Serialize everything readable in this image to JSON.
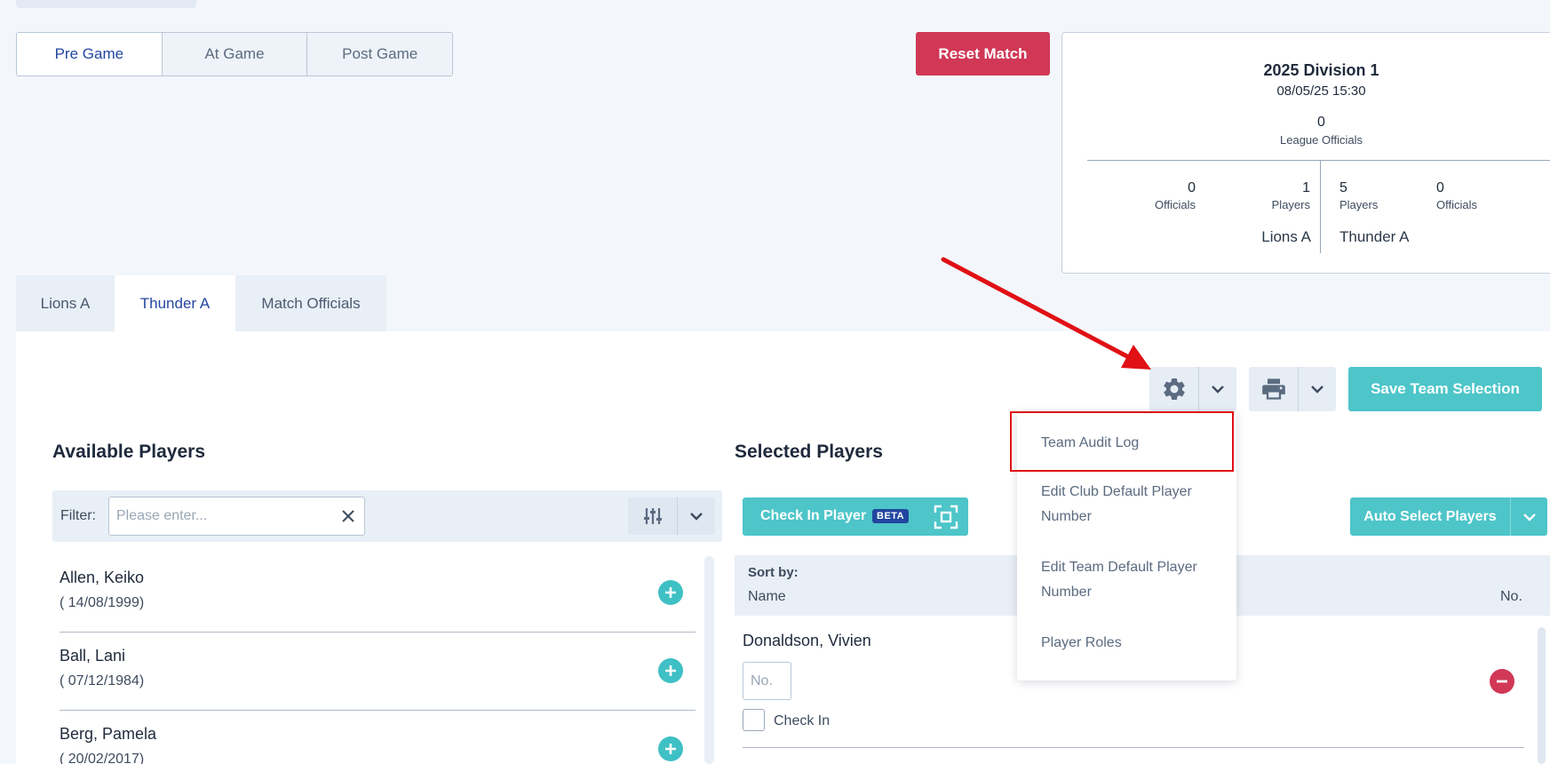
{
  "phase_tabs": {
    "pre_game": "Pre Game",
    "at_game": "At Game",
    "post_game": "Post Game"
  },
  "reset_label": "Reset Match",
  "match": {
    "title": "2025 Division 1",
    "datetime": "08/05/25 15:30",
    "league_officials_count": "0",
    "league_officials_label": "League Officials",
    "home": {
      "officials_count": "0",
      "officials_label": "Officials",
      "players_count": "1",
      "players_label": "Players",
      "team_name": "Lions A"
    },
    "away": {
      "players_count": "5",
      "players_label": "Players",
      "officials_count": "0",
      "officials_label": "Officials",
      "team_name": "Thunder A"
    }
  },
  "team_tabs": {
    "lions": "Lions A",
    "thunder": "Thunder A",
    "officials": "Match Officials"
  },
  "toolbar": {
    "save_label": "Save Team Selection"
  },
  "available": {
    "title": "Available Players",
    "filter_label": "Filter:",
    "filter_placeholder": "Please enter...",
    "players": [
      {
        "name": "Allen, Keiko",
        "dob": "( 14/08/1999)"
      },
      {
        "name": "Ball, Lani",
        "dob": "( 07/12/1984)"
      },
      {
        "name": "Berg, Pamela",
        "dob": "( 20/02/2017)"
      }
    ]
  },
  "selected": {
    "title": "Selected Players",
    "checkin_label": "Check In Player",
    "beta_label": "BETA",
    "auto_select_label": "Auto Select Players",
    "sort_by_label": "Sort by:",
    "col_name": "Name",
    "col_no": "No.",
    "players": [
      {
        "name": "Donaldson, Vivien",
        "no_placeholder": "No.",
        "checkin_text": "Check In"
      }
    ]
  },
  "settings_menu": {
    "items": [
      "Team Audit Log",
      "Edit Club Default Player Number",
      "Edit Team Default Player Number",
      "Player Roles"
    ]
  },
  "colors": {
    "primary": "#2246a0",
    "accent": "#4dc5c9",
    "danger": "#d03856",
    "annotation": "#e01015"
  }
}
